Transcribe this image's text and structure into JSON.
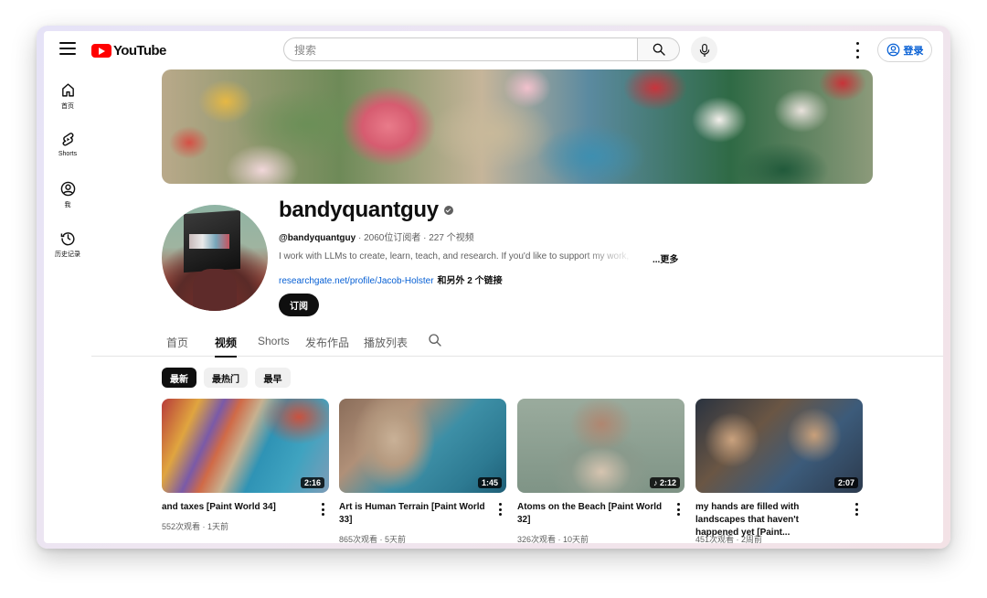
{
  "header": {
    "logo_text": "YouTube",
    "search_placeholder": "搜索",
    "signin_label": "登录"
  },
  "nav": {
    "items": [
      {
        "label": "首页",
        "icon": "home-icon"
      },
      {
        "label": "Shorts",
        "icon": "shorts-icon"
      },
      {
        "label": "我",
        "icon": "account-icon"
      },
      {
        "label": "历史记录",
        "icon": "history-icon"
      }
    ]
  },
  "channel": {
    "name": "bandyquantguy",
    "handle": "@bandyquantguy",
    "subscribers": "2060位订阅者",
    "video_count": "227 个视频",
    "separator": " · ",
    "description": "I work with LLMs to create, learn, teach, and research. If you'd like to support my work,",
    "more_label": "...更多",
    "link_text": "researchgate.net/profile/Jacob-Holster",
    "link_extra": "和另外 2 个链接",
    "subscribe_label": "订阅"
  },
  "tabs": [
    {
      "label": "首页",
      "active": false
    },
    {
      "label": "视频",
      "active": true
    },
    {
      "label": "Shorts",
      "active": false
    },
    {
      "label": "发布作品",
      "active": false
    },
    {
      "label": "播放列表",
      "active": false
    }
  ],
  "chips": [
    {
      "label": "最新",
      "active": true
    },
    {
      "label": "最热门",
      "active": false
    },
    {
      "label": "最早",
      "active": false
    }
  ],
  "videos": [
    {
      "title": "and taxes [Paint World 34]",
      "meta": "552次观看 · 1天前",
      "duration": "2:16"
    },
    {
      "title": "Art is Human Terrain [Paint World 33]",
      "meta": "865次观看 · 5天前",
      "duration": "1:45"
    },
    {
      "title": "Atoms on the Beach [Paint World 32]",
      "meta": "326次观看 · 10天前",
      "duration": "2:12"
    },
    {
      "title": "my hands are filled with landscapes that haven't happened yet [Paint...",
      "meta": "451次观看 · 2周前",
      "duration": "2:07"
    }
  ],
  "colors": {
    "brand_red": "#ff0000",
    "link_blue": "#065fd4",
    "text_primary": "#0f0f0f",
    "text_secondary": "#606060"
  }
}
